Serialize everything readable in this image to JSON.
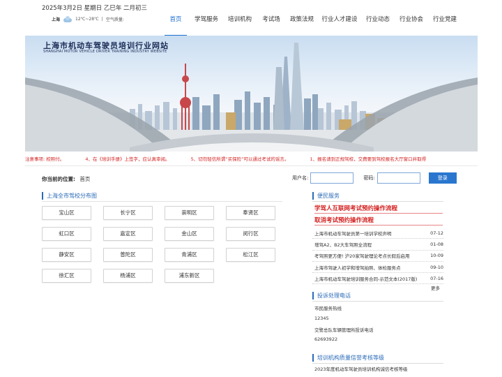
{
  "header": {
    "date": "2025年3月2日 星期日 乙巳年 二月初三",
    "weather": {
      "city": "上海",
      "temp": "12℃~28℃",
      "sep": "|",
      "air": "空气质量:"
    }
  },
  "nav": [
    {
      "label": "首页",
      "active": true
    },
    {
      "label": "学驾服务"
    },
    {
      "label": "培训机构"
    },
    {
      "label": "考试场"
    },
    {
      "label": "政策法规"
    },
    {
      "label": "行业人才建设"
    },
    {
      "label": "行业动态"
    },
    {
      "label": "行业协会"
    },
    {
      "label": "行业党建"
    }
  ],
  "banner": {
    "title": "上海市机动车驾驶员培训行业网站",
    "subtitle": "SHANGHAI MOTOR VEHICLE DRIVER TRAINING INDUSTRY WEBSITE"
  },
  "notices": [
    "注意事项: 校照付。",
    "4、在《培训手册》上签字，应认真审阅。",
    "5、切勿轻信所谓“买保险”可以通过考试的谣言。",
    "1、报名请到正规驾校，交费要到驾校报名大厅窗口并取得"
  ],
  "location": {
    "label": "你当前的位置:",
    "value": "首页"
  },
  "login": {
    "user_label": "用户名:",
    "pass_label": "密码:",
    "button": "登录"
  },
  "school_map": {
    "title": "上海全市驾校分布图",
    "districts": [
      "宝山区",
      "长宁区",
      "崇明区",
      "奉贤区",
      "虹口区",
      "嘉定区",
      "金山区",
      "闵行区",
      "静安区",
      "普陀区",
      "青浦区",
      "松江区",
      "徐汇区",
      "杨浦区",
      "浦东新区"
    ]
  },
  "citizen_service": {
    "title": "便民服务",
    "hot_links": [
      "学驾人互联网考试预约操作流程",
      "取消考试预约操作流程"
    ],
    "news": [
      {
        "title": "上海市机动车驾驶员第一培训学校声明",
        "date": "07-12"
      },
      {
        "title": "增驾A2、B2大车驾照全流程",
        "date": "01-08"
      },
      {
        "title": "考驾照更方便! 沪20家驾驶理论考点长假后启用",
        "date": "10-09"
      },
      {
        "title": "上海市驾驶人初学和增驾拍照、体检服务点",
        "date": "09-10"
      },
      {
        "title": "上海市机动车驾驶培训服务合同-示范文本(2017版)",
        "date": "07-16"
      }
    ],
    "more": "更多"
  },
  "complaint": {
    "title": "投诉处理电话",
    "lines": [
      "市民服务热线",
      "12345",
      "交警总队车辆管理所投诉电话",
      "62693922"
    ]
  },
  "quality": {
    "title": "培训机构质量信誉考核等级",
    "items": [
      "2023年度机动车驾驶员培训机构诚信考核等级"
    ]
  },
  "colors": {
    "accent": "#1e6fd0",
    "alert": "#d42020",
    "section": "#2a6ab8"
  }
}
